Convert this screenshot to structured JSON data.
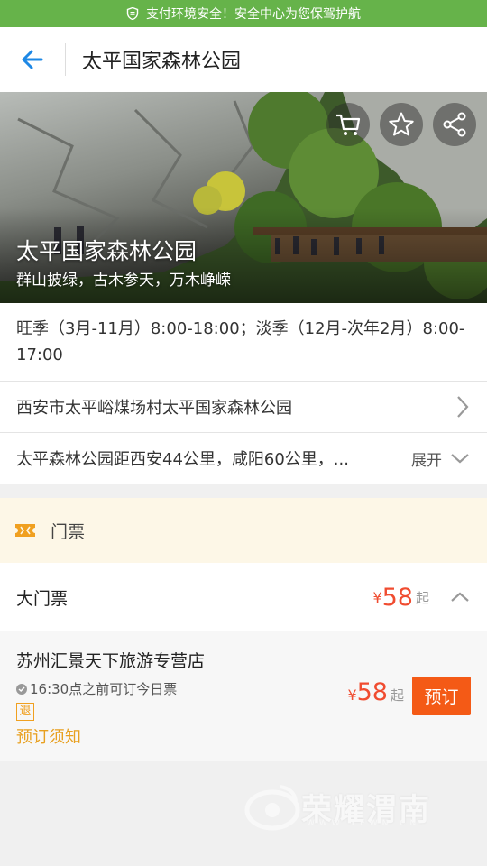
{
  "security_banner": {
    "text": "支付环境安全！安全中心为您保驾护航",
    "icon": "shield-icon",
    "color": "#66b34a"
  },
  "nav": {
    "title": "太平国家森林公园",
    "back_icon": "arrow-left-icon",
    "accent": "#1e88e5"
  },
  "hero": {
    "title": "太平国家森林公园",
    "subtitle": "群山披绿，古木参天，万木峥嵘",
    "actions": [
      "cart-icon",
      "star-icon",
      "share-icon"
    ]
  },
  "info": {
    "hours": "旺季（3月-11月）8:00-18:00；淡季（12月-次年2月）8:00-17:00",
    "address": "西安市太平峪煤场村太平国家森林公园",
    "description": "太平森林公园距西安44公里，咸阳60公里，...",
    "expand_label": "展开"
  },
  "tickets": {
    "section_label": "门票",
    "items": [
      {
        "name": "大门票",
        "currency": "¥",
        "price": "58",
        "suffix": "起",
        "vendors": [
          {
            "name": "苏州汇景天下旅游专营店",
            "cutoff": "16:30点之前可订今日票",
            "refund_badge": "退",
            "notice_link": "预订须知",
            "currency": "¥",
            "price": "58",
            "suffix": "起",
            "book_label": "预订"
          }
        ]
      }
    ]
  },
  "watermark": {
    "text": "荣耀渭南",
    "url": "WWW.YEWN.CN"
  },
  "colors": {
    "price": "#f04c30",
    "book_button": "#f45a16",
    "notice": "#e8a020",
    "ticket_bg": "#fdf7e7"
  }
}
